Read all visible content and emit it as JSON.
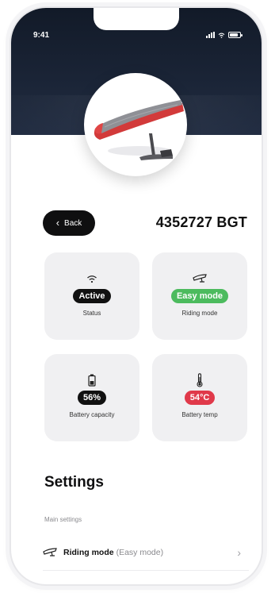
{
  "status_bar": {
    "time": "9:41"
  },
  "header": {
    "back_label": "Back",
    "device_id": "4352727 BGT"
  },
  "cards": {
    "status": {
      "value": "Active",
      "caption": "Status",
      "color": "#111111"
    },
    "riding": {
      "value": "Easy mode",
      "caption": "Riding mode",
      "color": "#4CBB5E"
    },
    "battery": {
      "value": "56%",
      "caption": "Battery capacity",
      "color": "#111111"
    },
    "temp": {
      "value": "54°C",
      "caption": "Battery temp",
      "color": "#E0394A"
    }
  },
  "settings": {
    "title": "Settings",
    "section_label": "Main settings",
    "rows": [
      {
        "icon": "riding-mode-icon",
        "title": "Riding mode",
        "value": "(Easy mode)"
      }
    ]
  },
  "icons": {
    "status": "wifi-icon",
    "riding": "riding-mode-icon",
    "battery": "battery-icon",
    "temp": "thermometer-icon"
  },
  "colors": {
    "hero_bg": "#1a2436",
    "card_bg": "#f0f0f2",
    "accent_green": "#4CBB5E",
    "accent_red": "#E0394A"
  }
}
